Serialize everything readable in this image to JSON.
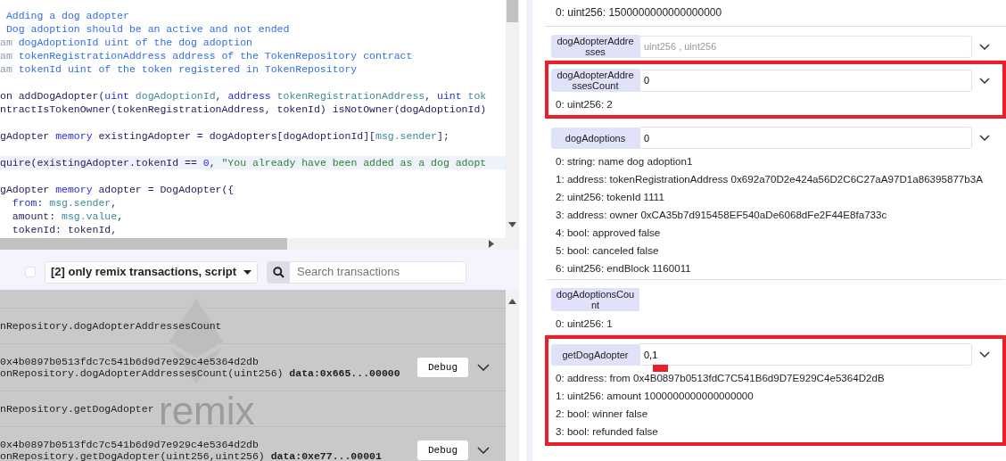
{
  "editor": {
    "lines": [
      {
        "highlighted": false,
        "tokens": [
          {
            "text": " Adding a dog adopter",
            "kind": "comment"
          }
        ]
      },
      {
        "highlighted": false,
        "tokens": [
          {
            "text": " Dog adoption should be an active and not ended",
            "kind": "comment"
          }
        ]
      },
      {
        "highlighted": false,
        "tokens": [
          {
            "text": "am",
            "kind": "tag"
          },
          {
            "text": " dogAdoptionId uint of the dog adoption",
            "kind": "comment"
          }
        ]
      },
      {
        "highlighted": false,
        "tokens": [
          {
            "text": "am",
            "kind": "tag"
          },
          {
            "text": " tokenRegistrationAddress address of the TokenRepository contract",
            "kind": "comment"
          }
        ]
      },
      {
        "highlighted": false,
        "tokens": [
          {
            "text": "am",
            "kind": "tag"
          },
          {
            "text": " tokenId uint of the token registered in TokenRepository",
            "kind": "comment"
          }
        ]
      },
      {
        "highlighted": false
      },
      {
        "highlighted": false,
        "tokens": [
          {
            "text": "on addDogAdopter(",
            "kind": "plain"
          },
          {
            "text": "uint",
            "kind": "keyword"
          },
          {
            "text": " dogAdoptionId",
            "kind": "var"
          },
          {
            "text": ", ",
            "kind": "plain"
          },
          {
            "text": "address",
            "kind": "keyword"
          },
          {
            "text": " tokenRegistrationAddress",
            "kind": "var"
          },
          {
            "text": ", ",
            "kind": "plain"
          },
          {
            "text": "uint",
            "kind": "keyword"
          },
          {
            "text": " tok",
            "kind": "var"
          }
        ]
      },
      {
        "highlighted": false,
        "tokens": [
          {
            "text": "ntractIsTokenOwner(tokenRegistrationAddress, tokenId) isNotOwner(dogAdoptionId)",
            "kind": "plain"
          }
        ]
      },
      {
        "highlighted": false
      },
      {
        "highlighted": false,
        "tokens": [
          {
            "text": "gAdopter ",
            "kind": "plain"
          },
          {
            "text": "memory",
            "kind": "keyword"
          },
          {
            "text": " existingAdopter = dogAdopters[dogAdoptionId][",
            "kind": "plain"
          },
          {
            "text": "msg.sender",
            "kind": "var"
          },
          {
            "text": "];",
            "kind": "plain"
          }
        ]
      },
      {
        "highlighted": false
      },
      {
        "highlighted": true,
        "tokens": [
          {
            "text": "quire(existingAdopter.tokenId == ",
            "kind": "plain"
          },
          {
            "text": "0",
            "kind": "number"
          },
          {
            "text": ", ",
            "kind": "plain"
          },
          {
            "text": "\"You already have been added as a dog adopt",
            "kind": "string"
          }
        ]
      },
      {
        "highlighted": false
      },
      {
        "highlighted": false,
        "tokens": [
          {
            "text": "gAdopter ",
            "kind": "plain"
          },
          {
            "text": "memory",
            "kind": "keyword"
          },
          {
            "text": " adopter = DogAdopter({",
            "kind": "plain"
          }
        ]
      },
      {
        "highlighted": false,
        "tokens": [
          {
            "text": "  from",
            "kind": "keyword"
          },
          {
            "text": ": ",
            "kind": "plain"
          },
          {
            "text": "msg.sender",
            "kind": "var"
          },
          {
            "text": ",",
            "kind": "plain"
          }
        ]
      },
      {
        "highlighted": false,
        "tokens": [
          {
            "text": "  amount: ",
            "kind": "plain"
          },
          {
            "text": "msg.value",
            "kind": "var"
          },
          {
            "text": ",",
            "kind": "plain"
          }
        ]
      },
      {
        "highlighted": false,
        "tokens": [
          {
            "text": "  tokenId: tokenId,",
            "kind": "plain"
          }
        ]
      }
    ]
  },
  "terminal": {
    "checked": false,
    "filter": "[2] only remix transactions, script",
    "search": {
      "placeholder": "Search transactions"
    },
    "watermark": "remix",
    "entries": [
      {
        "kind": "call",
        "lines": [
          "nRepository.dogAdopterAddressesCount"
        ]
      },
      {
        "kind": "tx",
        "lines": [
          "0x4b0897b0513fdc7c541b6d9d7e929c4e5364d2db",
          "onRepository.dogAdopterAddressesCount(uint256) **data:0x665...00000**"
        ],
        "button": "Debug"
      },
      {
        "kind": "call",
        "lines": [
          "nRepository.getDogAdopter"
        ]
      },
      {
        "kind": "tx",
        "lines": [
          "0x4b0897b0513fdc7c541b6d9d7e929c4e5364d2db",
          "onRepository.getDogAdopter(uint256,uint256) **data:0xe77...00001**"
        ],
        "button": "Debug"
      }
    ]
  },
  "functions_panel": {
    "top_output": "0: uint256: 1500000000000000000",
    "functions": [
      {
        "name": "dogAdopterAddresses",
        "placeholder": "uint256 , uint256",
        "highlighted": false
      },
      {
        "name": "dogAdopterAddressesCount",
        "value": "0",
        "highlighted": true,
        "outputs": [
          "0: uint256: 2"
        ]
      },
      {
        "name": "dogAdoptions",
        "value": "0",
        "highlighted": false,
        "outputs": [
          "0: string: name dog adoption1",
          "1: address: tokenRegistrationAddress 0x692a70D2e424a56D2C6C27aA97D1a86395877b3A",
          "2: uint256: tokenId 1111",
          "3: address: owner 0xCA35b7d915458EF540aDe6068dFe2F44E8fa733c",
          "4: bool: approved false",
          "5: bool: canceled false",
          "6: uint256: endBlock 1160011"
        ]
      },
      {
        "name": "dogAdoptionsCount",
        "highlighted": false,
        "outputs": [
          "0: uint256: 1"
        ]
      },
      {
        "name": "getDogAdopter",
        "value": "0,1",
        "highlighted": true,
        "marked": true,
        "outputs": [
          "0: address: from 0x4B0897b0513fdC7C541B6d9D7E929C4e5364D2dB",
          "1: uint256: amount 1000000000000000000",
          "2: bool: winner false",
          "3: bool: refunded false"
        ]
      }
    ]
  }
}
